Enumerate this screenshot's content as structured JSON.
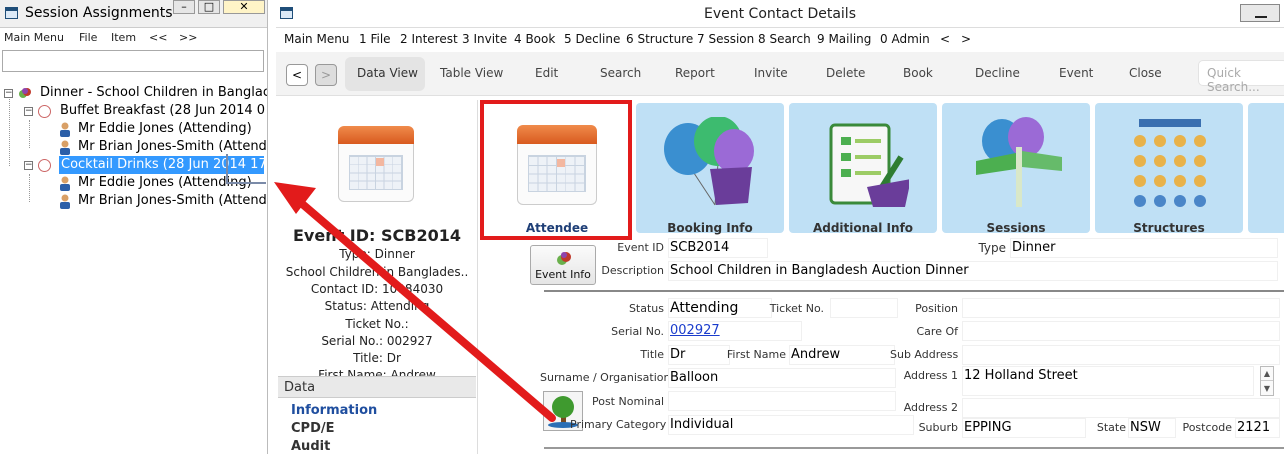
{
  "left_window": {
    "title": "Session Assignments",
    "menu": [
      "Main Menu",
      "File",
      "Item",
      "<<",
      ">>"
    ],
    "tree": [
      {
        "label": "Dinner - School Children in Banglac",
        "level": 0
      },
      {
        "label": "Buffet Breakfast (28 Jun 2014 0",
        "level": 1
      },
      {
        "label": "Mr Eddie Jones (Attending)",
        "level": 2
      },
      {
        "label": "Mr Brian Jones-Smith (Attend",
        "level": 2
      },
      {
        "label": "Cocktail Drinks (28 Jun 2014 17",
        "level": 1,
        "selected": true
      },
      {
        "label": "Mr Eddie Jones (Attending)",
        "level": 2
      },
      {
        "label": "Mr Brian Jones-Smith (Attend",
        "level": 2
      }
    ]
  },
  "main_window": {
    "title": "Event Contact Details",
    "menu": [
      "Main Menu",
      "1 File",
      "2 Interest",
      "3 Invite",
      "4 Book",
      "5 Decline",
      "6 Structure",
      "7 Session",
      "8 Search",
      "9 Mailing",
      "0 Admin",
      "<",
      ">"
    ],
    "nav_back": "<",
    "nav_forward": ">",
    "toolbar": [
      "Data View",
      "Table View",
      "Edit",
      "Search",
      "Report",
      "Invite",
      "Delete",
      "Book",
      "Decline",
      "Event",
      "Close"
    ],
    "quick_search_placeholder": "Quick Search..."
  },
  "summary": {
    "event_id": "Event ID: SCB2014",
    "type": "Type: Dinner",
    "description": "School Children in Banglades..",
    "contact_id": "Contact ID: 10084030",
    "status": "Status: Attending",
    "ticket": "Ticket No.:",
    "serial": "Serial No.: 002927",
    "title": "Title: Dr",
    "first_name": "First Name: Andrew"
  },
  "data_panel": {
    "header": "Data",
    "links": [
      "Information",
      "CPD/E",
      "Audit"
    ]
  },
  "tiles": [
    "Attendee",
    "Booking Info",
    "Additional Info",
    "Sessions",
    "Structures"
  ],
  "event_info_button": "Event Info",
  "form": {
    "labels": {
      "event_id": "Event ID",
      "type": "Type",
      "description": "Description",
      "status": "Status",
      "ticket_no": "Ticket No.",
      "position": "Position",
      "serial_no": "Serial No.",
      "care_of": "Care Of",
      "title": "Title",
      "first_name": "First Name",
      "sub_address": "Sub Address",
      "surname": "Surname / Organisation",
      "address1": "Address 1",
      "post_nominal": "Post Nominal",
      "address2": "Address 2",
      "primary_category": "Primary Category",
      "suburb": "Suburb",
      "state": "State",
      "postcode": "Postcode"
    },
    "values": {
      "event_id": "SCB2014",
      "type": "Dinner",
      "description": "School Children in Bangladesh Auction Dinner",
      "status": "Attending",
      "ticket_no": "",
      "position": "",
      "serial_no": "002927",
      "care_of": "",
      "title": "Dr",
      "first_name": "Andrew",
      "sub_address": "",
      "surname": "Balloon",
      "address1": "12 Holland Street",
      "post_nominal": "",
      "address2": "",
      "primary_category": "Individual",
      "suburb": "EPPING",
      "state": "NSW",
      "postcode": "2121"
    }
  },
  "colors": {
    "selection": "#3399ff",
    "tile_bg": "#bfe0f5",
    "highlight_box": "#e21b1b",
    "link": "#1f4e9f"
  }
}
